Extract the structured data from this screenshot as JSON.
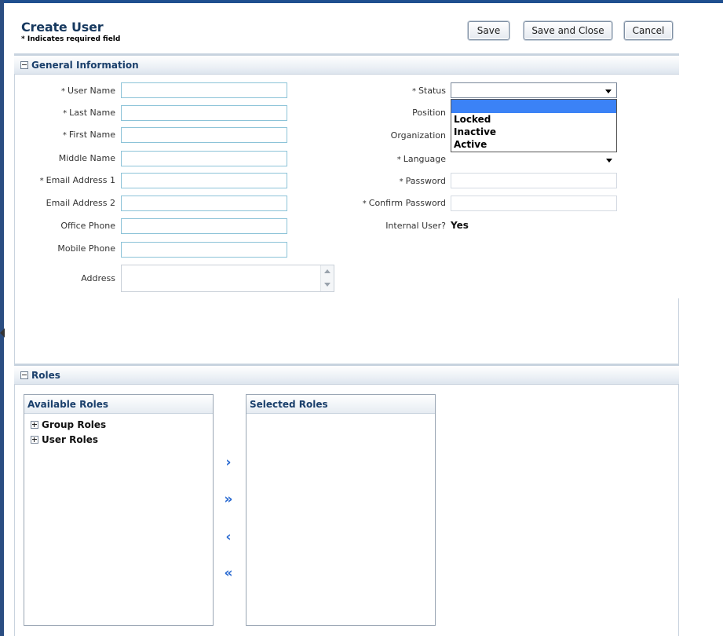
{
  "header": {
    "title": "Create User",
    "required_note": "* Indicates required field"
  },
  "toolbar": {
    "save_label": "Save",
    "save_close_label": "Save and Close",
    "cancel_label": "Cancel"
  },
  "general_section": {
    "title": "General Information",
    "left_labels": {
      "user_name": "User Name",
      "last_name": "Last Name",
      "first_name": "First Name",
      "middle_name": "Middle Name",
      "email1": "Email Address 1",
      "email2": "Email Address 2",
      "office_phone": "Office Phone",
      "mobile_phone": "Mobile Phone",
      "address": "Address"
    },
    "right_labels": {
      "status": "Status",
      "position": "Position",
      "organization": "Organization",
      "language": "Language",
      "password": "Password",
      "confirm_password": "Confirm Password",
      "internal_user": "Internal User?"
    },
    "required_marker": "*",
    "internal_user_value": "Yes",
    "status_options": [
      "",
      "Locked",
      "Inactive",
      "Active"
    ]
  },
  "roles_section": {
    "title": "Roles",
    "available_title": "Available Roles",
    "selected_title": "Selected Roles",
    "available_items": [
      "Group Roles",
      "User Roles"
    ],
    "shuttle": {
      "move": "›",
      "move_all": "»",
      "remove": "‹",
      "remove_all": "«"
    }
  },
  "colors": {
    "brand": "#1f4f8f",
    "accent": "#2a6ad1",
    "selected_option": "#3b82f6"
  }
}
